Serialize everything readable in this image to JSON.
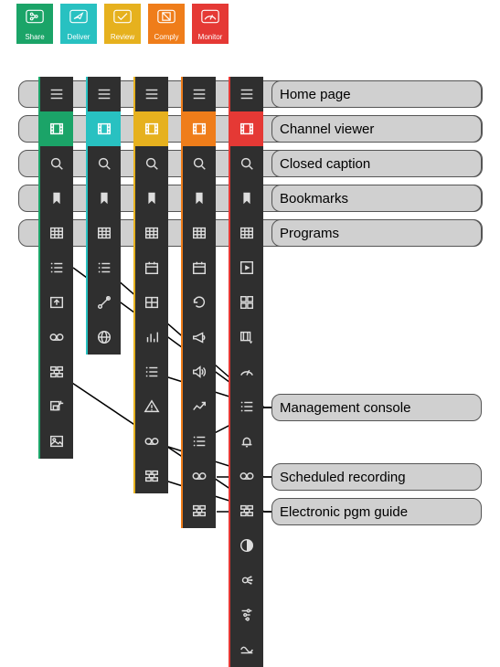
{
  "tabs": {
    "share": {
      "label": "Share",
      "color": "green"
    },
    "deliver": {
      "label": "Deliver",
      "color": "cyan"
    },
    "review": {
      "label": "Review",
      "color": "yellow"
    },
    "comply": {
      "label": "Comply",
      "color": "orange"
    },
    "monitor": {
      "label": "Monitor",
      "color": "red"
    }
  },
  "labels": {
    "home": "Home page",
    "channel": "Channel viewer",
    "caption": "Closed caption",
    "bookmarks": "Bookmarks",
    "programs": "Programs",
    "mconsole": "Management console",
    "schedrec": "Scheduled recording",
    "epg": "Electronic pgm guide"
  },
  "columns": {
    "share": [
      "menu",
      "film",
      "search",
      "bookmark",
      "grid",
      "list",
      "export",
      "voicemail",
      "bricks",
      "boxarrow",
      "image"
    ],
    "deliver": [
      "menu",
      "film",
      "search",
      "bookmark",
      "grid",
      "list",
      "route",
      "globe"
    ],
    "review": [
      "menu",
      "film",
      "search",
      "bookmark",
      "grid",
      "cal",
      "table",
      "bars",
      "list",
      "alert",
      "voicemail",
      "bricks"
    ],
    "comply": [
      "menu",
      "film",
      "search",
      "bookmark",
      "grid",
      "cal",
      "refresh",
      "megaphone",
      "volume",
      "trend",
      "list",
      "voicemail",
      "bricks"
    ],
    "monitor": [
      "menu",
      "film",
      "search",
      "bookmark",
      "grid",
      "play",
      "grid4",
      "filmlock",
      "gauge",
      "list",
      "bell",
      "voicemail",
      "bricks",
      "contrast",
      "sliders",
      "filter",
      "wave"
    ]
  },
  "colors": {
    "green": "#1ba468",
    "cyan": "#28c1c1",
    "yellow": "#e6b11e",
    "orange": "#ef7d1a",
    "red": "#e53935",
    "bar": "#2f2f2f",
    "label": "#d0d0d0"
  }
}
